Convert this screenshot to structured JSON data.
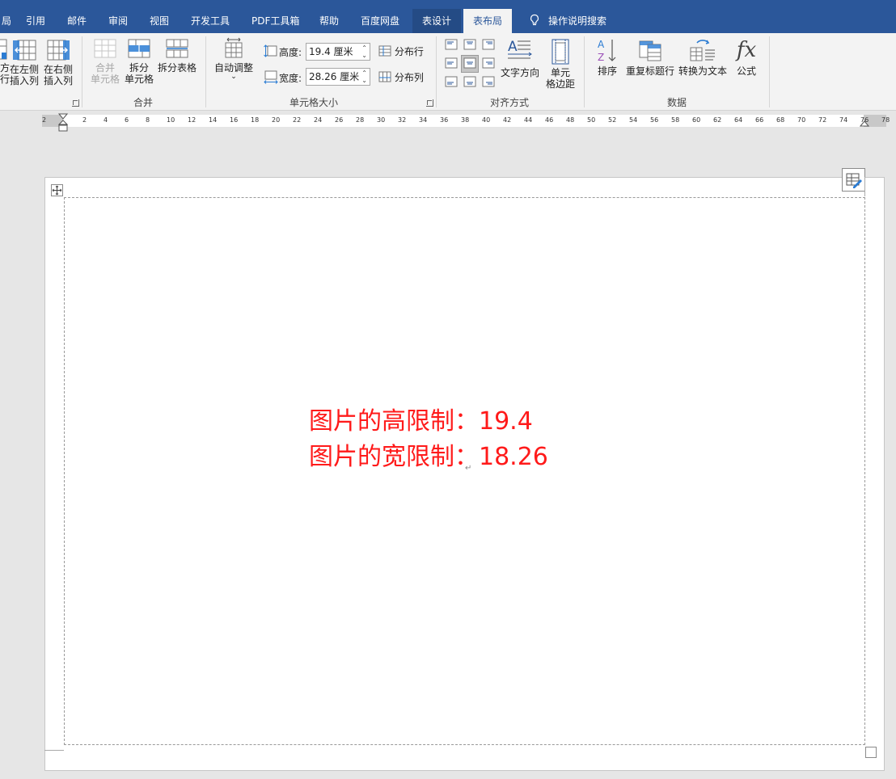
{
  "tabs": [
    {
      "label": "局",
      "active": false
    },
    {
      "label": "引用",
      "active": false
    },
    {
      "label": "邮件",
      "active": false
    },
    {
      "label": "审阅",
      "active": false
    },
    {
      "label": "视图",
      "active": false
    },
    {
      "label": "开发工具",
      "active": false
    },
    {
      "label": "PDF工具箱",
      "active": false
    },
    {
      "label": "帮助",
      "active": false
    },
    {
      "label": "百度网盘",
      "active": false
    },
    {
      "label": "表设计",
      "active": false
    },
    {
      "label": "表布局",
      "active": true
    }
  ],
  "search_tab": "操作说明搜索",
  "ribbon": {
    "rows_cols": {
      "insert_below_l1": "方",
      "insert_below_l2": "行",
      "insert_left_l1": "在左侧",
      "insert_left_l2": "插入列",
      "insert_right_l1": "在右侧",
      "insert_right_l2": "插入列"
    },
    "merge": {
      "merge_cells_l1": "合并",
      "merge_cells_l2": "单元格",
      "split_cells_l1": "拆分",
      "split_cells_l2": "单元格",
      "split_table": "拆分表格",
      "group_label": "合并"
    },
    "cell_size": {
      "autofit": "自动调整",
      "height_label": "高度:",
      "height_value": "19.4 厘米",
      "width_label": "宽度:",
      "width_value": "28.26 厘米",
      "distribute_rows": "分布行",
      "distribute_cols": "分布列",
      "group_label": "单元格大小"
    },
    "alignment": {
      "text_direction": "文字方向",
      "cell_margins_l1": "单元",
      "cell_margins_l2": "格边距",
      "group_label": "对齐方式"
    },
    "data": {
      "sort": "排序",
      "repeat_header": "重复标题行",
      "convert_to_text": "转换为文本",
      "formula": "公式",
      "group_label": "数据"
    }
  },
  "ruler_ticks": [
    "2",
    "2",
    "4",
    "6",
    "8",
    "10",
    "12",
    "14",
    "16",
    "18",
    "20",
    "22",
    "24",
    "26",
    "28",
    "30",
    "32",
    "34",
    "36",
    "38",
    "40",
    "42",
    "44",
    "46",
    "48",
    "50",
    "52",
    "54",
    "56",
    "58",
    "60",
    "62",
    "64",
    "66",
    "68",
    "70",
    "72",
    "74",
    "76",
    "78"
  ],
  "document": {
    "line1": "图片的高限制：19.4",
    "line2": "图片的宽限制：18.26"
  },
  "colors": {
    "title_blue": "#2b579a",
    "doc_text_red": "#ff1a1a"
  }
}
